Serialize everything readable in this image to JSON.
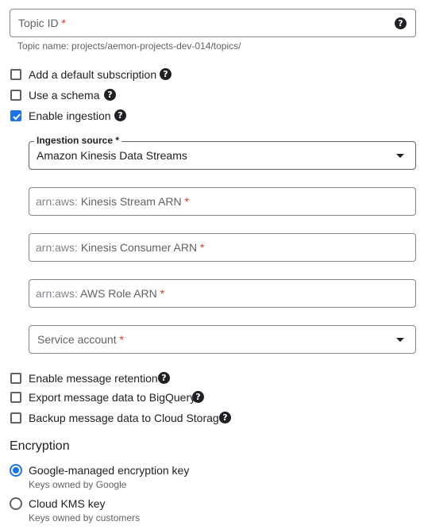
{
  "topic_id": {
    "label": "Topic ID",
    "required_mark": "*",
    "hint": "Topic name: projects/aemon-projects-dev-014/topics/"
  },
  "options": {
    "default_subscription": "Add a default subscription",
    "use_schema": "Use a schema",
    "enable_ingestion": "Enable ingestion",
    "enable_ingestion_checked": true
  },
  "ingestion": {
    "source_label": "Ingestion source",
    "source_required": "*",
    "source_value": "Amazon Kinesis Data Streams",
    "stream_arn": {
      "prefix": "arn:aws:",
      "label": "Kinesis Stream ARN",
      "required": "*"
    },
    "consumer_arn": {
      "prefix": "arn:aws:",
      "label": "Kinesis Consumer ARN",
      "required": "*"
    },
    "role_arn": {
      "prefix": "arn:aws:",
      "label": "AWS Role ARN",
      "required": "*"
    },
    "service_account": {
      "label": "Service account",
      "required": "*"
    }
  },
  "more_options": {
    "retention": "Enable message retention",
    "bigquery": "Export message data to BigQuery",
    "cloud_storage": "Backup message data to Cloud Storage"
  },
  "encryption": {
    "heading": "Encryption",
    "google_key": {
      "label": "Google-managed encryption key",
      "sub": "Keys owned by Google",
      "selected": true
    },
    "kms_key": {
      "label": "Cloud KMS key",
      "sub": "Keys owned by customers",
      "selected": false
    }
  },
  "help_glyph": "?",
  "colors": {
    "accent": "#1a73e8",
    "required": "#d93025",
    "text": "#202124",
    "muted": "#5f6368"
  }
}
